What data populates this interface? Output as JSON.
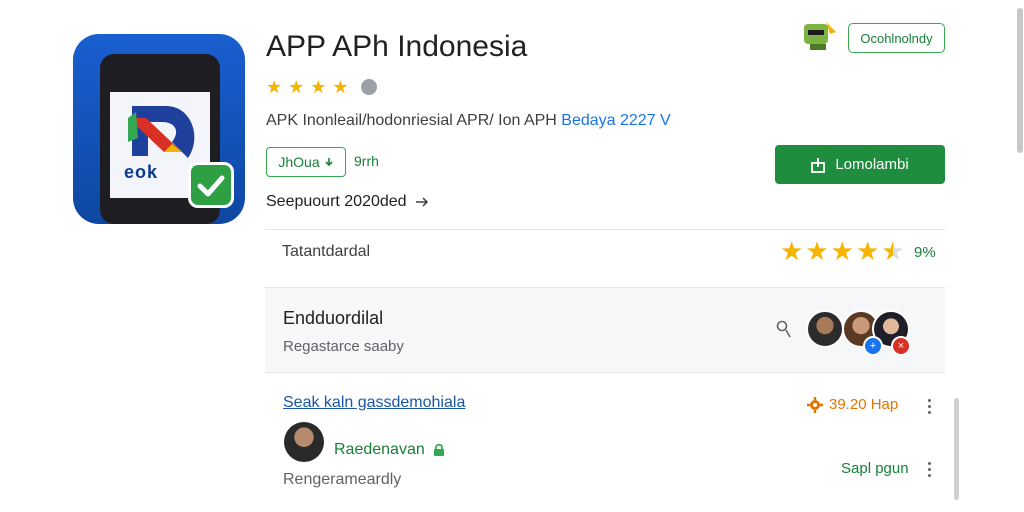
{
  "app": {
    "title": "APP APh Indonesia",
    "subtitle_main": "APK Inonleail/hodonriesial APR/ Ion APH",
    "subtitle_accent": "Bedaya 2227 V",
    "rating_stars": 4,
    "tag_label": "JhOua",
    "tag_extra": "9rrh",
    "support_text": "Seepuourt 2020ded",
    "logo_text": "eok"
  },
  "top_badge": {
    "label": "Ocohlnolndy"
  },
  "install_button": {
    "label": "Lomolambi"
  },
  "rating": {
    "label": "Tatantdardal",
    "stars": 4.5,
    "percent": "9%"
  },
  "endorsement": {
    "title": "Endduordilal",
    "subtitle": "Regastarce saaby"
  },
  "review": {
    "link_text": "Seak kaln gassdemohiala",
    "meta": "39.20 Hap",
    "user_name": "Raedenavan",
    "text": "Rengerameardly",
    "reply": "Sapl pgun"
  },
  "colors": {
    "accent_green": "#1e8e3e",
    "star_gold": "#f4b400",
    "link_blue": "#1a56a8",
    "meta_orange": "#e37400"
  },
  "icons": {
    "info": "info-icon",
    "arrow": "arrow-right-icon",
    "download": "download-icon",
    "person": "person-icon",
    "gear": "gear-icon",
    "lock": "lock-icon",
    "more": "more-vert-icon"
  }
}
